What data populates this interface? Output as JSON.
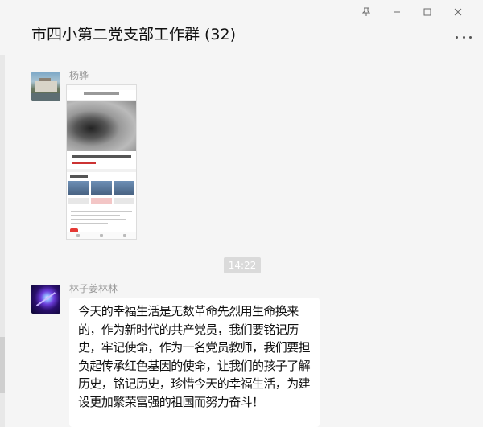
{
  "window": {
    "title": "市四小第二党支部工作群",
    "member_count": "(32)",
    "controls": {
      "pin_icon": "pin-icon",
      "minimize_icon": "minimize-icon",
      "maximize_icon": "maximize-icon",
      "close_icon": "close-icon"
    },
    "more_icon": "more-dots-icon"
  },
  "messages": [
    {
      "sender": "杨骅",
      "type": "image",
      "avatar_icon": "landscape-avatar"
    },
    {
      "type": "time",
      "time": "14:22"
    },
    {
      "sender": "林子姜林林",
      "type": "text",
      "avatar_icon": "nebula-avatar",
      "text": "今天的幸福生活是无数革命先烈用生命换来的，作为新时代的共产党员，我们要铭记历史，牢记使命，作为一名党员教师，我们要担负起传承红色基因的使命，让我们的孩子了解历史，铭记历史，珍惜今天的幸福生活，为建设更加繁荣富强的祖国而努力奋斗！"
    }
  ],
  "colors": {
    "background": "#f5f5f5",
    "bubble": "#ffffff",
    "time_badge": "#dadada",
    "sender_text": "#999999"
  }
}
